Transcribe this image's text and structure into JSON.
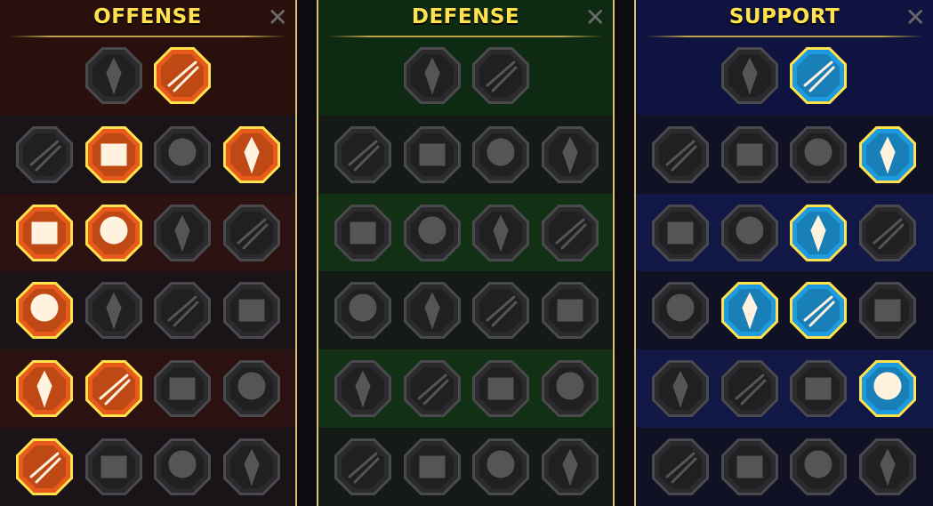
{
  "colors": {
    "offense_active": "#e85a1a",
    "defense_active": "#3a8f3a",
    "support_active": "#1e9be0",
    "inactive_fill": "#2b2b2e",
    "title": "#ffe24d",
    "frame": "#d8c070"
  },
  "panels": [
    {
      "id": "offense",
      "title": "OFFENSE",
      "close_label": "✕",
      "rows": [
        [
          {
            "icon": "crossed-swords-icon",
            "active": false
          },
          {
            "icon": "sword-slash-icon",
            "active": true
          }
        ],
        [
          {
            "icon": "demon-icon",
            "active": false
          },
          {
            "icon": "blade-strike-icon",
            "active": true
          },
          {
            "icon": "shield-bash-icon",
            "active": false
          },
          {
            "icon": "burning-heart-icon",
            "active": true
          }
        ],
        [
          {
            "icon": "arrows-hit-icon",
            "active": true
          },
          {
            "icon": "fangs-icon",
            "active": true
          },
          {
            "icon": "skull-slash-icon",
            "active": false
          },
          {
            "icon": "dagger-hand-icon",
            "active": false
          }
        ],
        [
          {
            "icon": "bleeding-heart-icon",
            "active": true
          },
          {
            "icon": "fist-icon",
            "active": false
          },
          {
            "icon": "axe-icon",
            "active": false
          },
          {
            "icon": "lightning-chain-icon",
            "active": false
          }
        ],
        [
          {
            "icon": "arrow-burst-icon",
            "active": true
          },
          {
            "icon": "twin-skulls-icon",
            "active": true
          },
          {
            "icon": "blade-ring-icon",
            "active": false
          },
          {
            "icon": "berserker-icon",
            "active": false
          }
        ],
        [
          {
            "icon": "sword-sparks-icon",
            "active": true
          },
          {
            "icon": "knight-helm-icon",
            "active": false
          },
          {
            "icon": "ogre-icon",
            "active": false
          },
          {
            "icon": "skull-burst-icon",
            "active": false
          }
        ]
      ]
    },
    {
      "id": "defense",
      "title": "DEFENSE",
      "close_label": "✕",
      "rows": [
        [
          {
            "icon": "armor-plates-icon",
            "active": false
          },
          {
            "icon": "raised-fist-icon",
            "active": false
          }
        ],
        [
          {
            "icon": "chevron-shield-icon",
            "active": false
          },
          {
            "icon": "heart-shield-icon",
            "active": false
          },
          {
            "icon": "warrior-icon",
            "active": false
          },
          {
            "icon": "crossed-blades-icon",
            "active": false
          }
        ],
        [
          {
            "icon": "archer-icon",
            "active": false
          },
          {
            "icon": "knight-shield-icon",
            "active": false
          },
          {
            "icon": "heart-skull-icon",
            "active": false
          },
          {
            "icon": "halo-figure-icon",
            "active": false
          }
        ],
        [
          {
            "icon": "crowd-icon",
            "active": false
          },
          {
            "icon": "hourglass-icon",
            "active": false
          },
          {
            "icon": "open-hand-icon",
            "active": false
          },
          {
            "icon": "bull-icon",
            "active": false
          }
        ],
        [
          {
            "icon": "dash-runner-icon",
            "active": false
          },
          {
            "icon": "claws-icon",
            "active": false
          },
          {
            "icon": "sun-skull-icon",
            "active": false
          },
          {
            "icon": "deflect-icon",
            "active": false
          }
        ],
        [
          {
            "icon": "king-icon",
            "active": false
          },
          {
            "icon": "crest-shield-icon",
            "active": false
          },
          {
            "icon": "hooded-face-icon",
            "active": false
          },
          {
            "icon": "strongman-icon",
            "active": false
          }
        ]
      ]
    },
    {
      "id": "support",
      "title": "SUPPORT",
      "close_label": "✕",
      "rows": [
        [
          {
            "icon": "heart-plus-icon",
            "active": false
          },
          {
            "icon": "target-wind-icon",
            "active": true
          }
        ],
        [
          {
            "icon": "praying-hands-icon",
            "active": false
          },
          {
            "icon": "arc-shield-icon",
            "active": false
          },
          {
            "icon": "poison-skull-icon",
            "active": false
          },
          {
            "icon": "wind-dash-icon",
            "active": true
          }
        ],
        [
          {
            "icon": "sparkle-figure-icon",
            "active": false
          },
          {
            "icon": "lightning-shield-icon",
            "active": false
          },
          {
            "icon": "cracked-ground-icon",
            "active": true
          },
          {
            "icon": "shadow-figures-icon",
            "active": false
          }
        ],
        [
          {
            "icon": "chained-heart-icon",
            "active": false
          },
          {
            "icon": "comet-icon",
            "active": true
          },
          {
            "icon": "open-book-icon",
            "active": true
          },
          {
            "icon": "angry-eyes-icon",
            "active": false
          }
        ],
        [
          {
            "icon": "compass-star-icon",
            "active": false
          },
          {
            "icon": "winged-boot-icon",
            "active": false
          },
          {
            "icon": "eye-icon",
            "active": false
          },
          {
            "icon": "dancing-figure-icon",
            "active": true
          }
        ],
        [
          {
            "icon": "potion-icon",
            "active": false
          },
          {
            "icon": "horned-skull-icon",
            "active": false
          },
          {
            "icon": "grabbing-fist-icon",
            "active": false
          },
          {
            "icon": "eagle-icon",
            "active": false
          }
        ]
      ]
    }
  ]
}
